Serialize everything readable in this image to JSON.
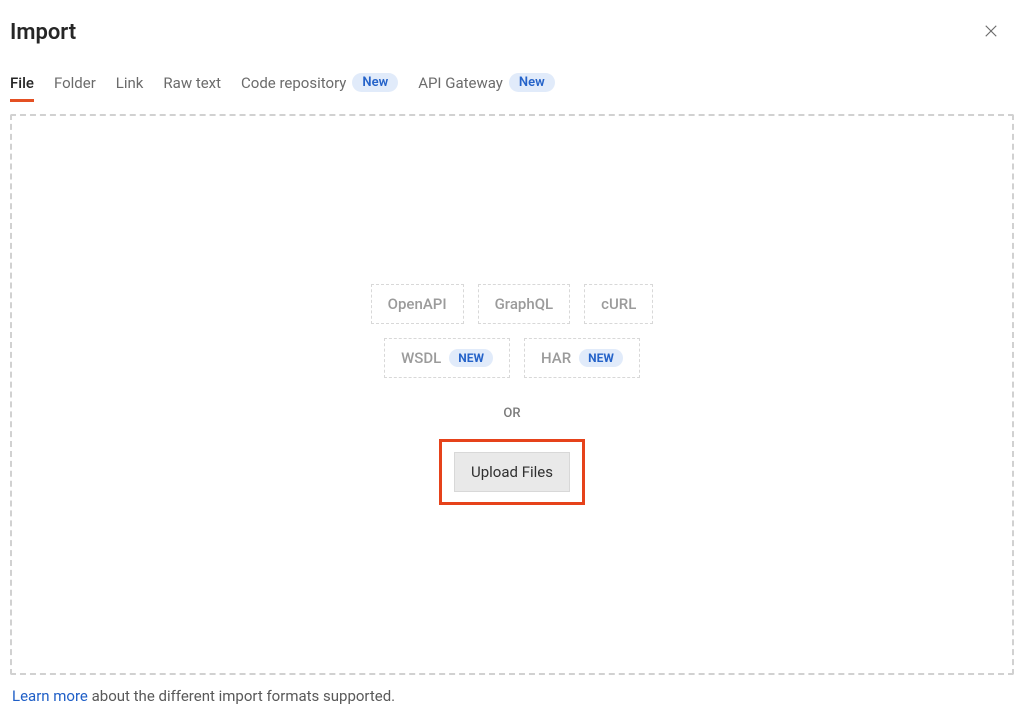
{
  "title": "Import",
  "tabs": [
    {
      "label": "File",
      "active": true
    },
    {
      "label": "Folder"
    },
    {
      "label": "Link"
    },
    {
      "label": "Raw text"
    },
    {
      "label": "Code repository",
      "badge": "New"
    },
    {
      "label": "API Gateway",
      "badge": "New"
    }
  ],
  "formats_row1": [
    {
      "label": "OpenAPI"
    },
    {
      "label": "GraphQL"
    },
    {
      "label": "cURL"
    }
  ],
  "formats_row2": [
    {
      "label": "WSDL",
      "badge": "NEW"
    },
    {
      "label": "HAR",
      "badge": "NEW"
    }
  ],
  "or_label": "OR",
  "upload_label": "Upload Files",
  "footer": {
    "link": "Learn more",
    "text": " about the different import formats supported."
  }
}
